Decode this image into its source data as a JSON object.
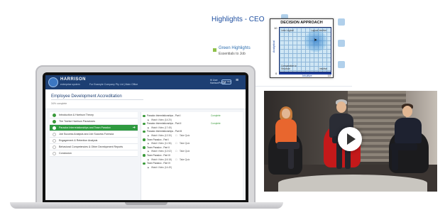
{
  "slide": {
    "title": "Highlights - CEO",
    "legend_label": "Green Highlights",
    "legend_sub": "Essentials to Job",
    "chart": {
      "title": "DECISION APPROACH",
      "y_label": "Analytical",
      "x_label": "Intuitive",
      "y_max": "10",
      "y_min": "0",
      "x_max": "10",
      "q_top_left": "Less Logical",
      "q_top_right": "Logical Intuitive",
      "q_bottom_left": "Comparative to Structure",
      "q_bottom_right": "Intuitive"
    }
  },
  "app": {
    "brand": "HARRISON",
    "brand_sub": "enterprise system",
    "company": "For Example Company Pty Ltd | Main Office",
    "user_line1": "Hi User",
    "user_line2": "HarrisonPerson",
    "sign_label": "Sign Out",
    "menu_icon": "≡",
    "page_title": "Employee Development Accreditation",
    "progress_text": "34% complete",
    "modules": [
      {
        "label": "Introduction & Harrison Theory",
        "state": "done"
      },
      {
        "label": "The Twelve Harrison Paradoxes",
        "state": "done"
      },
      {
        "label": "Paradox Interrelationships and Team Paradox",
        "state": "active"
      },
      {
        "label": "Job Success Analysis and Job Success Formula",
        "state": "todo"
      },
      {
        "label": "Engagement & Retention Analysis",
        "state": "todo"
      },
      {
        "label": "Behavioral Competencies & Other Development Reports",
        "state": "todo"
      },
      {
        "label": "Conclusion",
        "state": "todo"
      }
    ],
    "lessons": [
      {
        "kind": "head",
        "title": "Paradox Interrelationships - Part I",
        "status": "Complete"
      },
      {
        "kind": "video",
        "title": "Watch Video (14:20)",
        "quiz": ""
      },
      {
        "kind": "head",
        "title": "Paradox Interrelationships - Part II",
        "status": "Complete"
      },
      {
        "kind": "video",
        "title": "Watch Video (17:45)",
        "quiz": ""
      },
      {
        "kind": "head",
        "title": "Paradox Interrelationships - Part III",
        "status": ""
      },
      {
        "kind": "video",
        "title": "Watch Video (12:30)",
        "quiz": "Take Quiz"
      },
      {
        "kind": "head",
        "title": "Team Paradox - Part I",
        "status": ""
      },
      {
        "kind": "video",
        "title": "Watch Video (11:36)",
        "quiz": "Take Quiz"
      },
      {
        "kind": "head",
        "title": "Team Paradox - Part II",
        "status": ""
      },
      {
        "kind": "video",
        "title": "Watch Video (12:02)",
        "quiz": "Take Quiz"
      },
      {
        "kind": "head",
        "title": "Team Paradox - Part III",
        "status": ""
      },
      {
        "kind": "video",
        "title": "Watch Video (16:18)",
        "quiz": "Take Quiz"
      },
      {
        "kind": "head",
        "title": "Team Paradox - Part IV",
        "status": ""
      },
      {
        "kind": "video",
        "title": "Watch Video (14:49)",
        "quiz": ""
      }
    ]
  },
  "colors": {
    "app_bar": "#1d3f73",
    "accent_green": "#2e9a3f",
    "title_blue": "#1f4fa0"
  },
  "icons": {
    "play": "play-icon",
    "check": "check-icon",
    "video": "video-icon",
    "quiz": "quiz-icon",
    "arrow": "arrow-right-icon"
  }
}
